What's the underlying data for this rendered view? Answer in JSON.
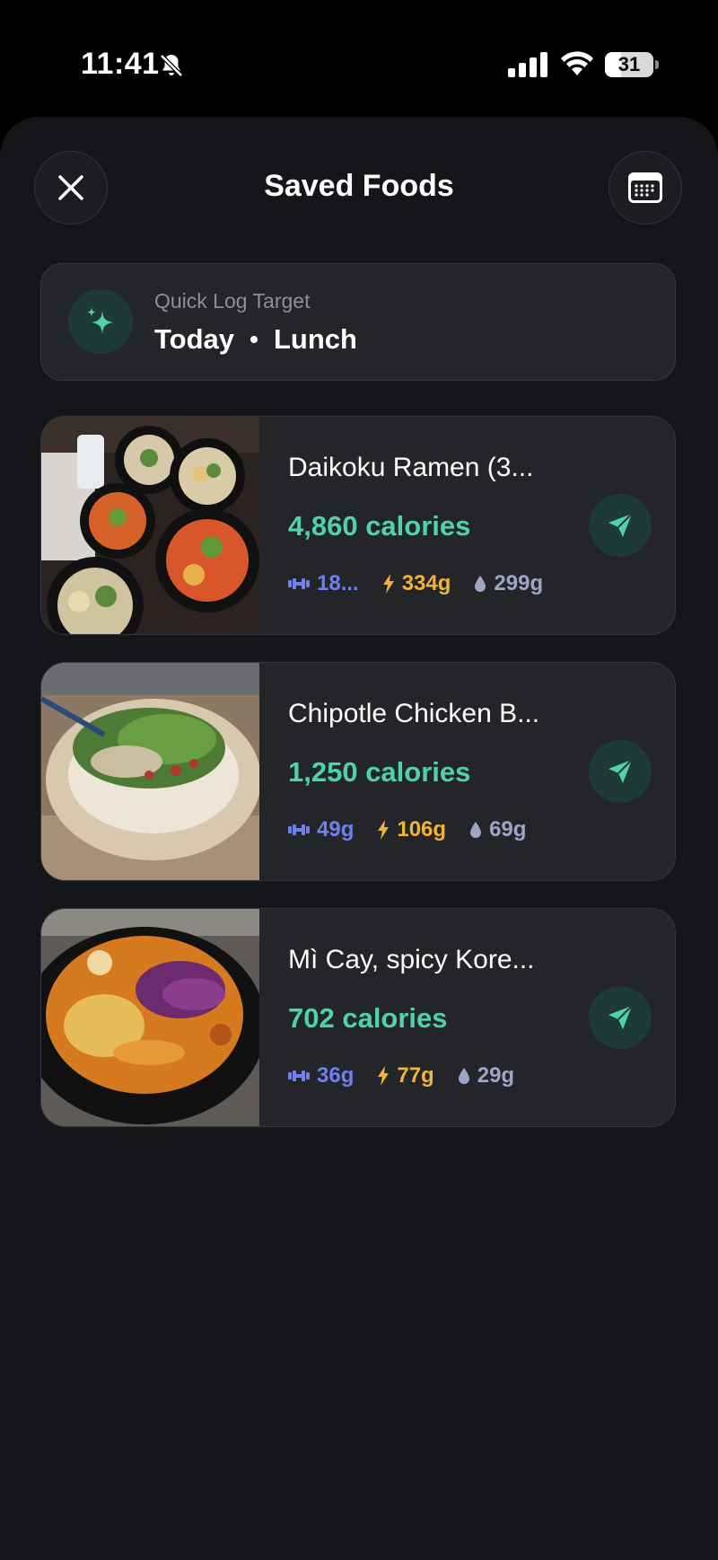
{
  "status_bar": {
    "time": "11:41",
    "battery": "31"
  },
  "header": {
    "title": "Saved Foods"
  },
  "quick_log": {
    "label": "Quick Log Target",
    "day": "Today",
    "meal": "Lunch"
  },
  "foods": [
    {
      "name": "Daikoku Ramen (3...",
      "calories": "4,860 calories",
      "protein": "18...",
      "carbs": "334g",
      "fat": "299g"
    },
    {
      "name": "Chipotle Chicken B...",
      "calories": "1,250 calories",
      "protein": "49g",
      "carbs": "106g",
      "fat": "69g"
    },
    {
      "name": "Mì Cay, spicy Kore...",
      "calories": "702 calories",
      "protein": "36g",
      "carbs": "77g",
      "fat": "29g"
    }
  ],
  "colors": {
    "accent": "#4fd1b0",
    "protein": "#6f7ff0",
    "carbs": "#f0b43a",
    "fat": "#9da6c6"
  },
  "icons": [
    "silent-bell-icon",
    "cellular-signal-icon",
    "wifi-icon",
    "battery-icon",
    "close-icon",
    "calendar-icon",
    "sparkles-icon",
    "dumbbell-icon",
    "lightning-icon",
    "droplet-icon",
    "send-icon"
  ]
}
